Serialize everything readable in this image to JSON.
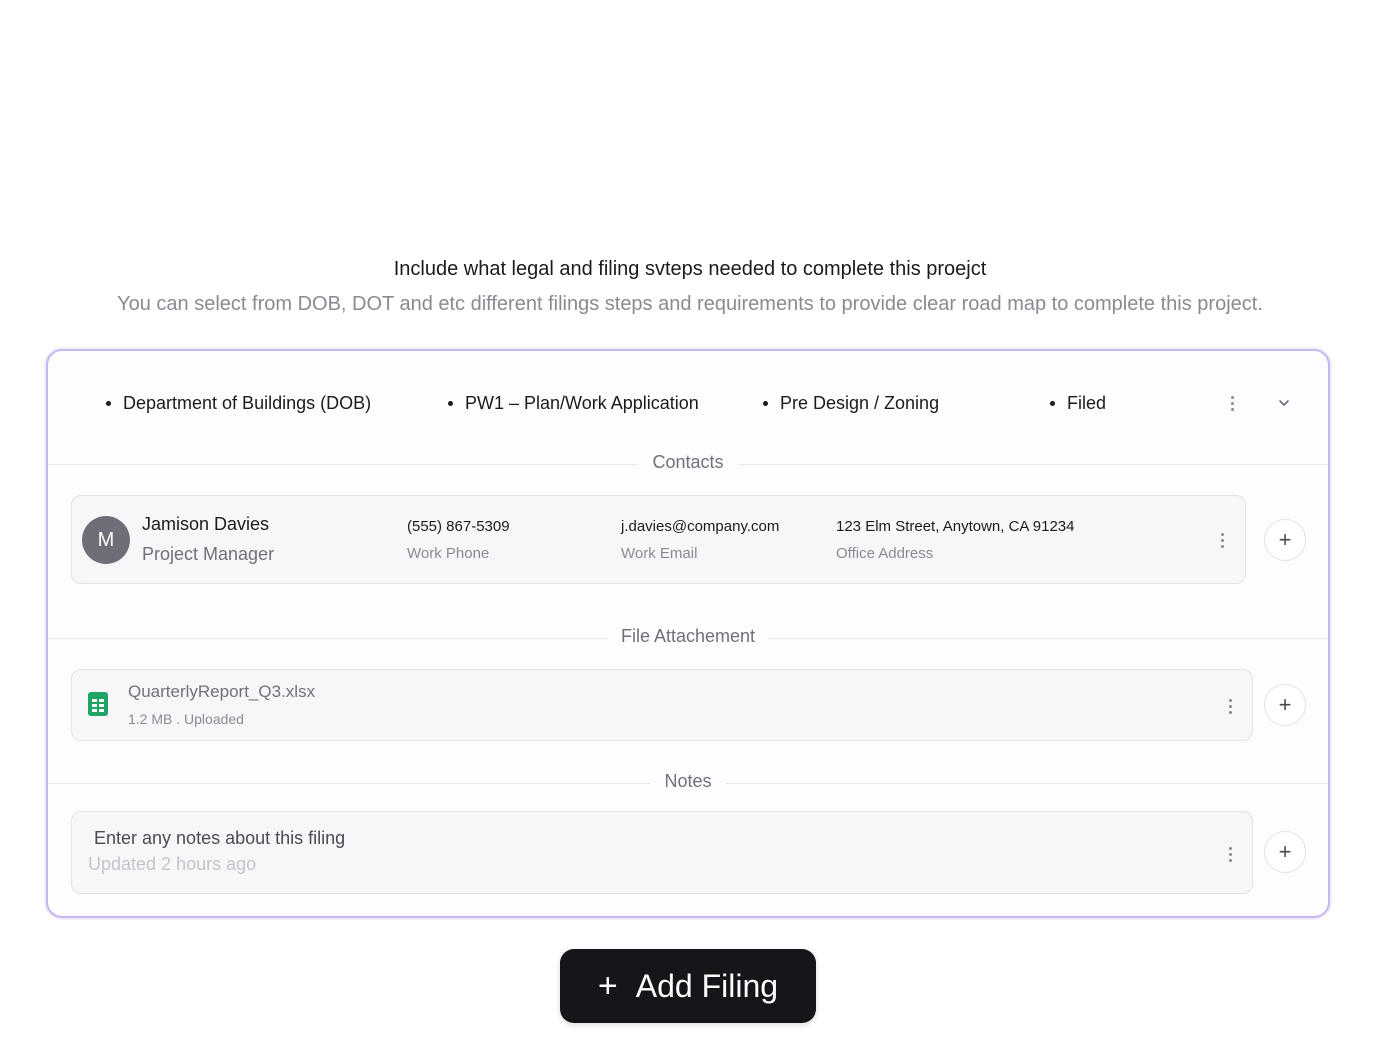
{
  "header": {
    "title": "Include what legal and filing svteps needed to complete this proejct",
    "subtitle": "You can select from DOB, DOT and etc different filings steps and requirements to provide clear road map to complete this project."
  },
  "filing": {
    "agency": "Department of Buildings (DOB)",
    "form": "PW1 – Plan/Work Application",
    "phase": "Pre Design / Zoning",
    "status": "Filed"
  },
  "contacts": {
    "section_label": "Contacts",
    "items": [
      {
        "initial": "M",
        "name": "Jamison Davies",
        "role": "Project Manager",
        "phone": "(555) 867-5309",
        "phone_label": "Work Phone",
        "email": "j.davies@company.com",
        "email_label": "Work Email",
        "address": "123 Elm Street, Anytown, CA 91234",
        "address_label": "Office Address"
      }
    ],
    "add_label": "+"
  },
  "attachments": {
    "section_label": "File Attachement",
    "items": [
      {
        "name": "QuarterlyReport_Q3.xlsx",
        "meta": "1.2 MB . Uploaded",
        "icon": "spreadsheet-file-icon"
      }
    ],
    "add_label": "+"
  },
  "notes": {
    "section_label": "Notes",
    "placeholder": "Enter any notes about this filing",
    "updated": "Updated 2 hours ago",
    "add_label": "+"
  },
  "actions": {
    "add_filing_icon": "+",
    "add_filing_label": "Add Filing"
  },
  "colors": {
    "card_border": "#c9b6f0",
    "button_bg": "#16161a",
    "spreadsheet_icon": "#1fa463"
  }
}
